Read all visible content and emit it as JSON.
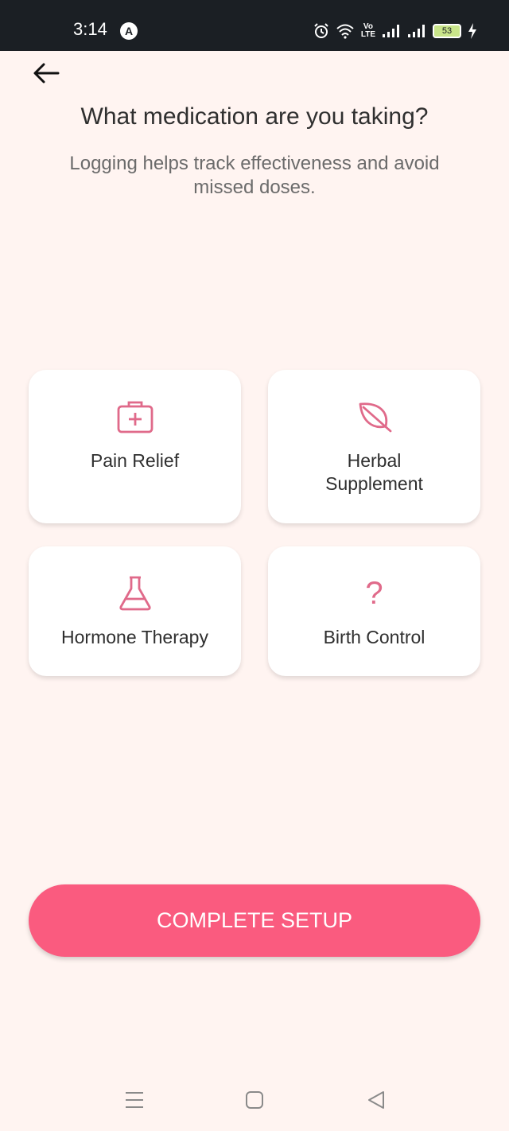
{
  "status_bar": {
    "time": "3:14",
    "notification_letter": "A",
    "battery": "53"
  },
  "header": {
    "title": "What medication are you taking?",
    "subtitle": "Logging helps track effectiveness and avoid missed doses."
  },
  "options": [
    {
      "label": "Pain Relief",
      "icon": "first-aid-kit-icon"
    },
    {
      "label": "Herbal Supplement",
      "icon": "leaf-icon"
    },
    {
      "label": "Hormone Therapy",
      "icon": "flask-icon"
    },
    {
      "label": "Birth Control",
      "icon": "question-mark-icon",
      "glyph": "?"
    }
  ],
  "actions": {
    "complete_label": "COMPLETE SETUP"
  },
  "colors": {
    "accent": "#fa5b7f",
    "icon": "#e06a8a",
    "background": "#fff4f1"
  }
}
